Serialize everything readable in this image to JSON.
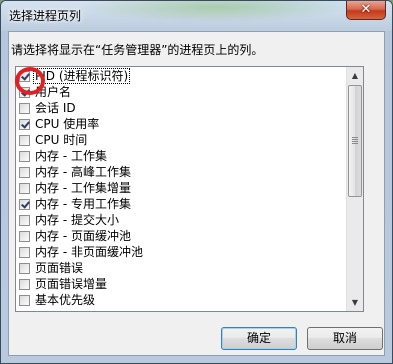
{
  "window": {
    "title": "选择进程页列",
    "close_symbol": "✕"
  },
  "dialog": {
    "instruction": "请选择将显示在“任务管理器”的进程页上的列。",
    "columns": [
      {
        "label": "PID (进程标识符)",
        "checked": true,
        "focused": true
      },
      {
        "label": "用户名",
        "checked": true,
        "focused": false
      },
      {
        "label": "会话 ID",
        "checked": false,
        "focused": false
      },
      {
        "label": "CPU 使用率",
        "checked": true,
        "focused": false
      },
      {
        "label": "CPU 时间",
        "checked": false,
        "focused": false
      },
      {
        "label": "内存 - 工作集",
        "checked": false,
        "focused": false
      },
      {
        "label": "内存 - 高峰工作集",
        "checked": false,
        "focused": false
      },
      {
        "label": "内存 - 工作集增量",
        "checked": false,
        "focused": false
      },
      {
        "label": "内存 - 专用工作集",
        "checked": true,
        "focused": false
      },
      {
        "label": "内存 - 提交大小",
        "checked": false,
        "focused": false
      },
      {
        "label": "内存 - 页面缓冲池",
        "checked": false,
        "focused": false
      },
      {
        "label": "内存 - 非页面缓冲池",
        "checked": false,
        "focused": false
      },
      {
        "label": "页面错误",
        "checked": false,
        "focused": false
      },
      {
        "label": "页面错误增量",
        "checked": false,
        "focused": false
      },
      {
        "label": "基本优先级",
        "checked": false,
        "focused": false
      }
    ],
    "ok_label": "确定",
    "cancel_label": "取消"
  },
  "icons": {
    "scroll_up": "scroll-up-arrow-icon",
    "scroll_down": "scroll-down-arrow-icon",
    "close": "close-icon",
    "checkmark": "checkmark-icon"
  },
  "colors": {
    "annotation": "#e51f1f",
    "close_button": "#c23a1c",
    "default_button_border": "#3c7fb1"
  }
}
